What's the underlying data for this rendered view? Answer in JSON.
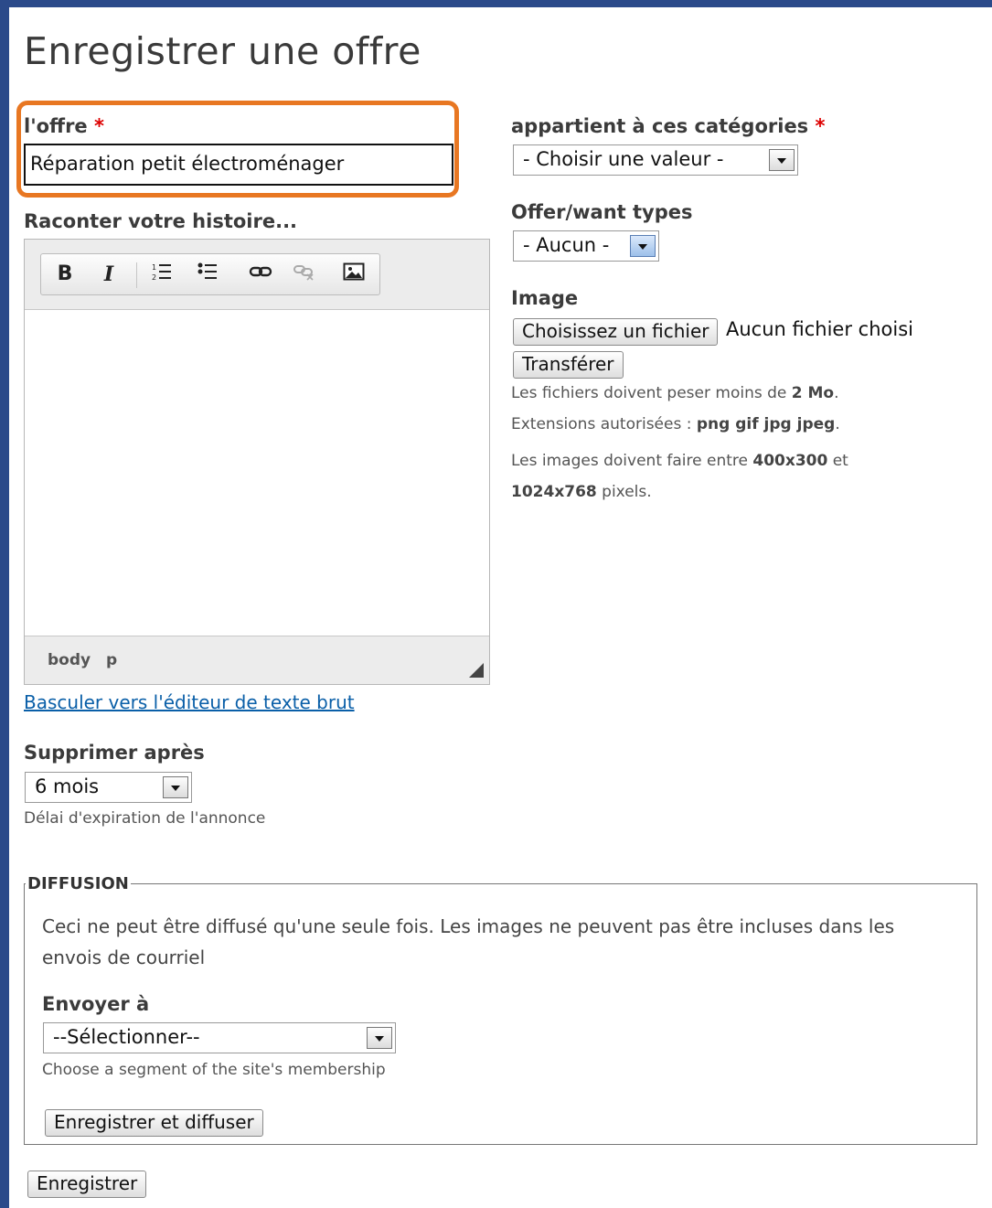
{
  "page_title": "Enregistrer une offre",
  "offer_field": {
    "label": "l'offre",
    "required_mark": "*",
    "value": "Réparation petit électroménager"
  },
  "story": {
    "label": "Raconter votre histoire...",
    "toolbar": {
      "bold": "B",
      "italic": "I"
    },
    "path": [
      "body",
      "p"
    ],
    "toggle_link": "Basculer vers l'éditeur de texte brut"
  },
  "categories": {
    "label": "appartient à ces catégories",
    "required_mark": "*",
    "selected": "- Choisir une valeur -"
  },
  "offer_types": {
    "label": "Offer/want types",
    "selected": "- Aucun -"
  },
  "image": {
    "label": "Image",
    "choose_button": "Choisissez un fichier",
    "no_file": "Aucun fichier choisi",
    "upload_button": "Transférer",
    "help_size_prefix": "Les fichiers doivent peser moins de ",
    "help_size_value": "2 Mo",
    "help_ext_prefix": "Extensions autorisées : ",
    "help_ext_value": "png gif jpg jpeg",
    "help_dim_prefix": "Les images doivent faire entre ",
    "help_dim_min": "400x300",
    "help_dim_and": " et",
    "help_dim_max": "1024x768",
    "help_dim_suffix": " pixels."
  },
  "expire": {
    "label": "Supprimer après",
    "selected": "6 mois",
    "description": "Délai d'expiration de l'annonce"
  },
  "diffusion": {
    "legend": "DIFFUSION",
    "notice_line1": "Ceci ne peut être diffusé qu'une seule fois. Les images ne peuvent pas être incluses dans les",
    "notice_line2": "envois de courriel",
    "send_label": "Envoyer à",
    "send_selected": "--Sélectionner--",
    "send_description": "Choose a segment of the site's membership",
    "save_diffuse_button": "Enregistrer et diffuser"
  },
  "save_button": "Enregistrer",
  "colors": {
    "highlight": "#e87722",
    "link": "#0a5fa8",
    "required": "#dd0000"
  }
}
